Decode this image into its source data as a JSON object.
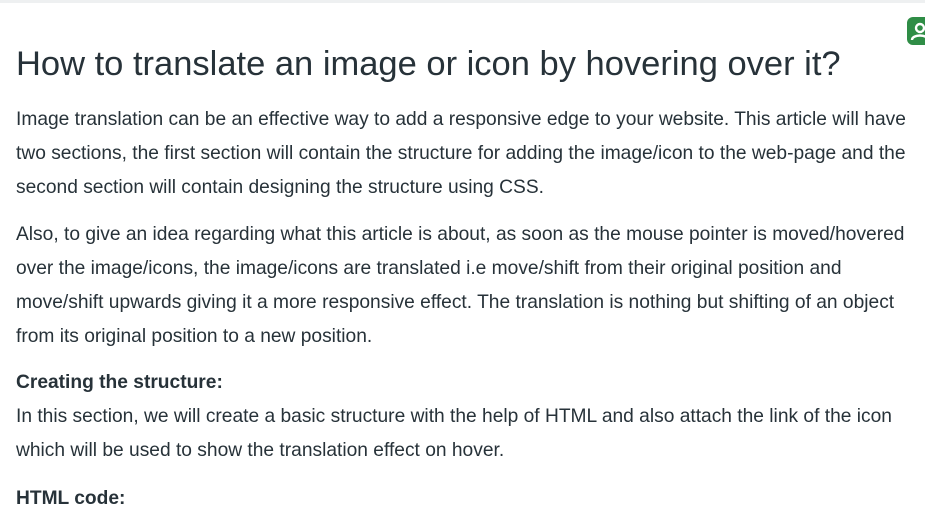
{
  "article": {
    "title": "How to translate an image or icon by hovering over it?",
    "paragraph_1": "Image translation can be an effective way to add a responsive edge to your website. This article will have two sections, the first section will contain the structure for adding the image/icon to the web-page and the second section will contain designing the structure using CSS.",
    "paragraph_2": "Also, to give an idea regarding what this article is about, as soon as the mouse pointer is moved/hovered over the image/icons, the image/icons are translated i.e move/shift from their original position and move/shift upwards giving it a more responsive effect. The translation is nothing but shifting of an object from its original position to a new position.",
    "section_heading_structure": "Creating the structure:",
    "paragraph_3": "In this section, we will create a basic structure with the help of HTML and also attach the link of the icon which will be used to show the translation effect on hover.",
    "section_heading_code": "HTML code:"
  },
  "side_badge": {
    "icon": "user-icon",
    "color": "#2f8d46"
  }
}
